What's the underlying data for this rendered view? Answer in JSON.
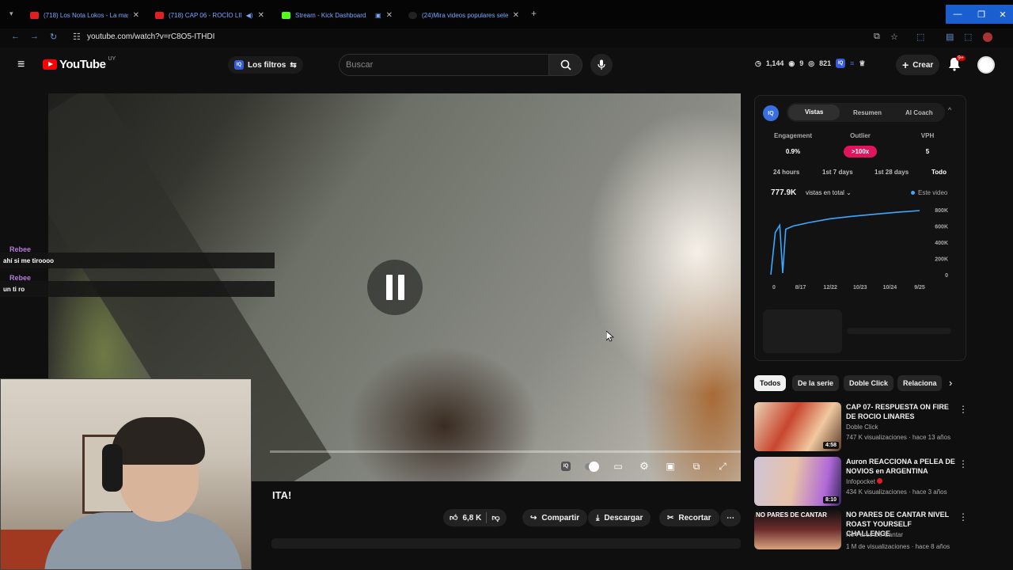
{
  "browser": {
    "tabs": [
      {
        "title": "(718) Los Nota Lokos - La mas",
        "fav": "#e02020"
      },
      {
        "title": "(718) CAP 06 - ROCÍO LINA",
        "fav": "#e02020"
      },
      {
        "title": "Stream - Kick Dashboard",
        "fav": "#53fc18"
      },
      {
        "title": "(24)Mira videos populares selec",
        "fav": "#222222"
      }
    ],
    "url": "youtube.com/watch?v=rC8O5-ITHDI"
  },
  "header": {
    "logo_text": "YouTube",
    "country": "UY",
    "filters_label": "Los filtros",
    "search_placeholder": "Buscar",
    "stats": {
      "a": "1,144",
      "b": "9",
      "c": "821"
    },
    "create_label": "Crear",
    "notif_count": "9+"
  },
  "chat": [
    {
      "name": "Rebee",
      "message": "ahí si me tiroooo"
    },
    {
      "name": "Rebee",
      "message": "un ti ro"
    }
  ],
  "video": {
    "title_fragment": "ITA!",
    "likes": "6,8 K",
    "share": "Compartir",
    "download": "Descargar",
    "clip": "Recortar",
    "progress": 0.0
  },
  "iq_panel": {
    "logo": "IQ",
    "tabs": [
      "Vistas",
      "Resumen",
      "AI Coach"
    ],
    "active_tab": "Vistas",
    "metrics": [
      {
        "label": "Engagement",
        "value": "0.9%"
      },
      {
        "label": "Outlier",
        "value": ">100x"
      },
      {
        "label": "VPH",
        "value": "5"
      }
    ],
    "periods": [
      "24 hours",
      "1st 7 days",
      "1st 28 days",
      "Todo"
    ],
    "active_period": "Todo",
    "total_views": "777.9K",
    "views_label": "vistas en total",
    "legend": "Este video"
  },
  "chart_data": {
    "type": "line",
    "x": [
      "0",
      "8/17",
      "12/22",
      "10/23",
      "10/24",
      "9/25"
    ],
    "y_ticks": [
      "800K",
      "600K",
      "400K",
      "200K",
      "0"
    ],
    "ylim": [
      0,
      800000
    ],
    "series": [
      {
        "name": "Este video",
        "color": "#3ea6ff",
        "points": [
          [
            0,
            0
          ],
          [
            0.03,
            520000
          ],
          [
            0.06,
            610000
          ],
          [
            0.08,
            20000
          ],
          [
            0.1,
            560000
          ],
          [
            0.15,
            600000
          ],
          [
            0.25,
            640000
          ],
          [
            0.4,
            690000
          ],
          [
            0.55,
            720000
          ],
          [
            0.7,
            745000
          ],
          [
            0.85,
            770000
          ],
          [
            1.0,
            790000
          ]
        ]
      }
    ]
  },
  "chips": [
    "Todos",
    "De la serie",
    "Doble Click",
    "Relaciona"
  ],
  "recommended": [
    {
      "title": "CAP 07- RESPUESTA ON FIRE DE ROCIO LINARES",
      "channel": "Doble Click",
      "meta": "747 K visualizaciones · hace 13 años",
      "duration": "4:58"
    },
    {
      "title": "Auron REACCIONA a PELEA DE NOVIOS en ARGENTINA",
      "channel": "Infopocket",
      "meta": "434 K visualizaciones · hace 3 años",
      "duration": "8:10"
    },
    {
      "title": "NO PARES DE CANTAR  NIVEL ROAST YOURSELF CHALLENGE",
      "channel": "No Pares De Cantar",
      "meta": "1 M de visualizaciones · hace 8 años",
      "duration": ""
    }
  ],
  "thumb3_caption": "NO PARES DE CANTAR",
  "colors": {
    "accent": "#ff0000",
    "outlier": "#e0155e",
    "iq_blue": "#3a6fe0"
  }
}
